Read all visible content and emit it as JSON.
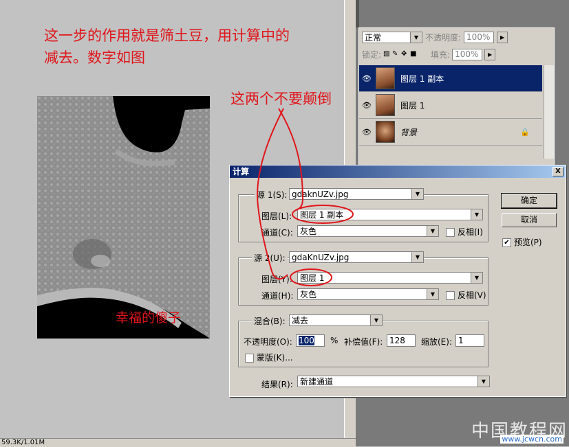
{
  "annotations": {
    "line1": "这一步的作用就是筛土豆，用计算中的",
    "line2": "减去。数字如图",
    "dont_reverse": "这两个不要颠倒",
    "signature": "幸福的傻子"
  },
  "status_bar": {
    "text": "59.3K/1.01M"
  },
  "layers_panel": {
    "blend_mode": "正常",
    "opacity_label": "不透明度:",
    "opacity_value": "100%",
    "lock_label": "锁定:",
    "fill_label": "填充:",
    "fill_value": "100%",
    "layers": [
      {
        "name": "图层 1 副本",
        "selected": true
      },
      {
        "name": "图层 1",
        "selected": false
      },
      {
        "name": "背景",
        "selected": false,
        "locked": true
      }
    ]
  },
  "dialog": {
    "title": "计算",
    "close_label": "X",
    "source1": {
      "label": "源 1(S):",
      "file": "gdaknUZv.jpg",
      "layer_label": "图层(L):",
      "layer": "图层 1 副本",
      "channel_label": "通道(C):",
      "channel": "灰色",
      "invert_label": "反相(I)"
    },
    "source2": {
      "label": "源 2(U):",
      "file": "gdaKnUZv.jpg",
      "layer_label": "图层(Y):",
      "layer": "图层 1",
      "channel_label": "通道(H):",
      "channel": "灰色",
      "invert_label": "反相(V)"
    },
    "blending": {
      "label": "混合(B):",
      "mode": "减去",
      "opacity_label": "不透明度(O):",
      "opacity": "100",
      "percent": "%",
      "offset_label": "补偿值(F):",
      "offset": "128",
      "scale_label": "缩放(E):",
      "scale": "1",
      "mask_label": "蒙版(K)..."
    },
    "result_label": "结果(R):",
    "result": "新建通道",
    "ok_label": "确定",
    "cancel_label": "取消",
    "preview_label": "预览(P)",
    "preview_checked": true
  },
  "watermark": {
    "text": "中国教程网",
    "url": "www.jcwcn.com"
  }
}
